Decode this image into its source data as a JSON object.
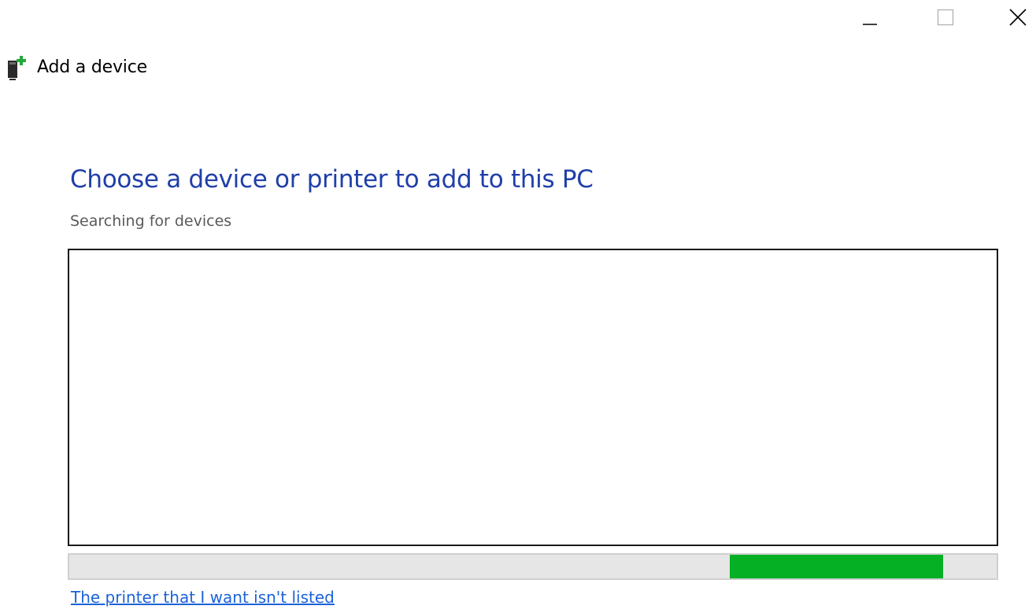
{
  "window": {
    "title": "Add a device",
    "controls": {
      "minimize_icon": "minimize-icon",
      "maximize_icon": "maximize-icon",
      "close_icon": "close-icon"
    }
  },
  "main": {
    "heading": "Choose a device or printer to add to this PC",
    "status_text": "Searching for devices",
    "device_list": [],
    "progress": {
      "type": "marquee",
      "segment_start": 0.712,
      "segment_end": 0.942
    },
    "link_text": "The printer that I want isn't listed"
  },
  "colors": {
    "heading": "#1f3fa8",
    "progress_fill": "#06b025",
    "link": "#1c63d8"
  },
  "icons": {
    "app_icon": "add-device-icon"
  }
}
